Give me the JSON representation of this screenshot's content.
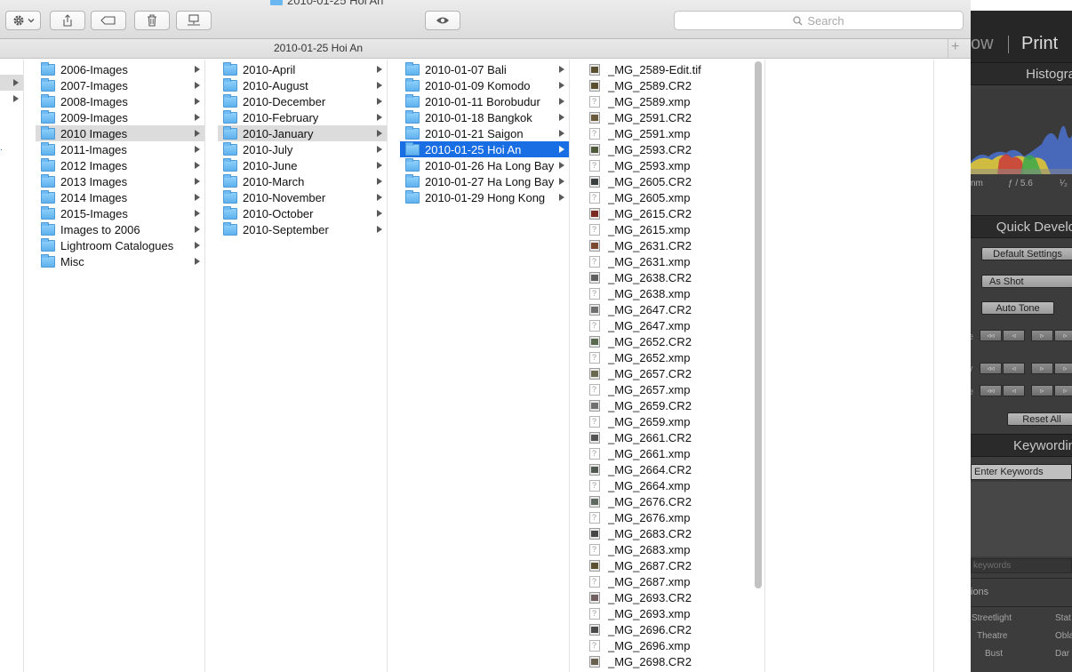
{
  "finder": {
    "window_title": "2010-01-25 Hoi An",
    "path_title": "2010-01-25 Hoi An",
    "search_placeholder": "Search",
    "toolbar_icons": [
      "gear-icon",
      "chevron-down-icon",
      "share-icon",
      "tag-icon",
      "trash-icon",
      "server-icon",
      "eye-icon",
      "search-icon"
    ],
    "colors": {
      "selection": "#1a6ee3",
      "folder": "#6ab6f0"
    },
    "columns": [
      {
        "items": [
          {
            "label": "2006-Images",
            "type": "folder",
            "state": ""
          },
          {
            "label": "2007-Images",
            "type": "folder",
            "state": ""
          },
          {
            "label": "2008-Images",
            "type": "folder",
            "state": ""
          },
          {
            "label": "2009-Images",
            "type": "folder",
            "state": ""
          },
          {
            "label": "2010 Images",
            "type": "folder",
            "state": "selected-inactive"
          },
          {
            "label": "2011-Images",
            "type": "folder",
            "state": ""
          },
          {
            "label": "2012 Images",
            "type": "folder",
            "state": ""
          },
          {
            "label": "2013 Images",
            "type": "folder",
            "state": ""
          },
          {
            "label": "2014 Images",
            "type": "folder",
            "state": ""
          },
          {
            "label": "2015-Images",
            "type": "folder",
            "state": ""
          },
          {
            "label": "Images to 2006",
            "type": "folder",
            "state": ""
          },
          {
            "label": "Lightroom Catalogues",
            "type": "folder",
            "state": ""
          },
          {
            "label": "Misc",
            "type": "folder",
            "state": ""
          }
        ]
      },
      {
        "items": [
          {
            "label": "2010-April",
            "type": "folder",
            "state": ""
          },
          {
            "label": "2010-August",
            "type": "folder",
            "state": ""
          },
          {
            "label": "2010-December",
            "type": "folder",
            "state": ""
          },
          {
            "label": "2010-February",
            "type": "folder",
            "state": ""
          },
          {
            "label": "2010-January",
            "type": "folder",
            "state": "selected-inactive"
          },
          {
            "label": "2010-July",
            "type": "folder",
            "state": ""
          },
          {
            "label": "2010-June",
            "type": "folder",
            "state": ""
          },
          {
            "label": "2010-March",
            "type": "folder",
            "state": ""
          },
          {
            "label": "2010-November",
            "type": "folder",
            "state": ""
          },
          {
            "label": "2010-October",
            "type": "folder",
            "state": ""
          },
          {
            "label": "2010-September",
            "type": "folder",
            "state": ""
          }
        ]
      },
      {
        "items": [
          {
            "label": "2010-01-07 Bali",
            "type": "folder",
            "state": ""
          },
          {
            "label": "2010-01-09 Komodo",
            "type": "folder",
            "state": ""
          },
          {
            "label": "2010-01-11 Borobudur",
            "type": "folder",
            "state": ""
          },
          {
            "label": "2010-01-18 Bangkok",
            "type": "folder",
            "state": ""
          },
          {
            "label": "2010-01-21 Saigon",
            "type": "folder",
            "state": ""
          },
          {
            "label": "2010-01-25 Hoi An",
            "type": "folder",
            "state": "selected-active"
          },
          {
            "label": "2010-01-26 Ha Long Bay",
            "type": "folder",
            "state": ""
          },
          {
            "label": "2010-01-27 Ha Long Bay",
            "type": "folder",
            "state": ""
          },
          {
            "label": "2010-01-29 Hong Kong",
            "type": "folder",
            "state": ""
          }
        ]
      },
      {
        "items": [
          {
            "label": "_MG_2589-Edit.tif",
            "type": "image",
            "thumb": "#5a5030"
          },
          {
            "label": "_MG_2589.CR2",
            "type": "image",
            "thumb": "#5a5030"
          },
          {
            "label": "_MG_2589.xmp",
            "type": "doc"
          },
          {
            "label": "_MG_2591.CR2",
            "type": "image",
            "thumb": "#6b5a3a"
          },
          {
            "label": "_MG_2591.xmp",
            "type": "doc"
          },
          {
            "label": "_MG_2593.CR2",
            "type": "image",
            "thumb": "#4f5a3a"
          },
          {
            "label": "_MG_2593.xmp",
            "type": "doc"
          },
          {
            "label": "_MG_2605.CR2",
            "type": "image",
            "thumb": "#3a4040"
          },
          {
            "label": "_MG_2605.xmp",
            "type": "doc"
          },
          {
            "label": "_MG_2615.CR2",
            "type": "image",
            "thumb": "#7a2a20"
          },
          {
            "label": "_MG_2615.xmp",
            "type": "doc"
          },
          {
            "label": "_MG_2631.CR2",
            "type": "image",
            "thumb": "#7a4a30"
          },
          {
            "label": "_MG_2631.xmp",
            "type": "doc"
          },
          {
            "label": "_MG_2638.CR2",
            "type": "image",
            "thumb": "#606060"
          },
          {
            "label": "_MG_2638.xmp",
            "type": "doc"
          },
          {
            "label": "_MG_2647.CR2",
            "type": "image",
            "thumb": "#707070"
          },
          {
            "label": "_MG_2647.xmp",
            "type": "doc"
          },
          {
            "label": "_MG_2652.CR2",
            "type": "image",
            "thumb": "#5a6a50"
          },
          {
            "label": "_MG_2652.xmp",
            "type": "doc"
          },
          {
            "label": "_MG_2657.CR2",
            "type": "image",
            "thumb": "#6a6a50"
          },
          {
            "label": "_MG_2657.xmp",
            "type": "doc"
          },
          {
            "label": "_MG_2659.CR2",
            "type": "image",
            "thumb": "#707070"
          },
          {
            "label": "_MG_2659.xmp",
            "type": "doc"
          },
          {
            "label": "_MG_2661.CR2",
            "type": "image",
            "thumb": "#555555"
          },
          {
            "label": "_MG_2661.xmp",
            "type": "doc"
          },
          {
            "label": "_MG_2664.CR2",
            "type": "image",
            "thumb": "#505a50"
          },
          {
            "label": "_MG_2664.xmp",
            "type": "doc"
          },
          {
            "label": "_MG_2676.CR2",
            "type": "image",
            "thumb": "#606a60"
          },
          {
            "label": "_MG_2676.xmp",
            "type": "doc"
          },
          {
            "label": "_MG_2683.CR2",
            "type": "image",
            "thumb": "#454545"
          },
          {
            "label": "_MG_2683.xmp",
            "type": "doc"
          },
          {
            "label": "_MG_2687.CR2",
            "type": "image",
            "thumb": "#5a5030"
          },
          {
            "label": "_MG_2687.xmp",
            "type": "doc"
          },
          {
            "label": "_MG_2693.CR2",
            "type": "image",
            "thumb": "#706060"
          },
          {
            "label": "_MG_2693.xmp",
            "type": "doc"
          },
          {
            "label": "_MG_2696.CR2",
            "type": "image",
            "thumb": "#4a4a4a"
          },
          {
            "label": "_MG_2696.xmp",
            "type": "doc"
          },
          {
            "label": "_MG_2698.CR2",
            "type": "image",
            "thumb": "#6a6050"
          }
        ]
      }
    ]
  },
  "lightroom": {
    "module_show": "ow",
    "module_print": "Print",
    "histogram_title": "Histogra",
    "histogram_info": {
      "left": "nm",
      "aperture": "ƒ / 5.6",
      "right": "¹⁄₂"
    },
    "quick_develop_title": "Quick Develo",
    "saved_preset": "Default Settings",
    "white_balance": "As Shot",
    "auto_tone": "Auto Tone",
    "step_labels": [
      "◃◃",
      "◃",
      "▹",
      "▹"
    ],
    "side_labels": [
      "e",
      "y",
      "e"
    ],
    "reset_all": "Reset All",
    "keywording_title": "Keywordin",
    "keyword_placeholder": "Enter Keywords",
    "keyword_suggestions": "keywords",
    "section_label": "ions",
    "presets": [
      "Streetlight",
      "Stat",
      "Theatre",
      "Obla",
      "Bust",
      "Dar"
    ]
  }
}
